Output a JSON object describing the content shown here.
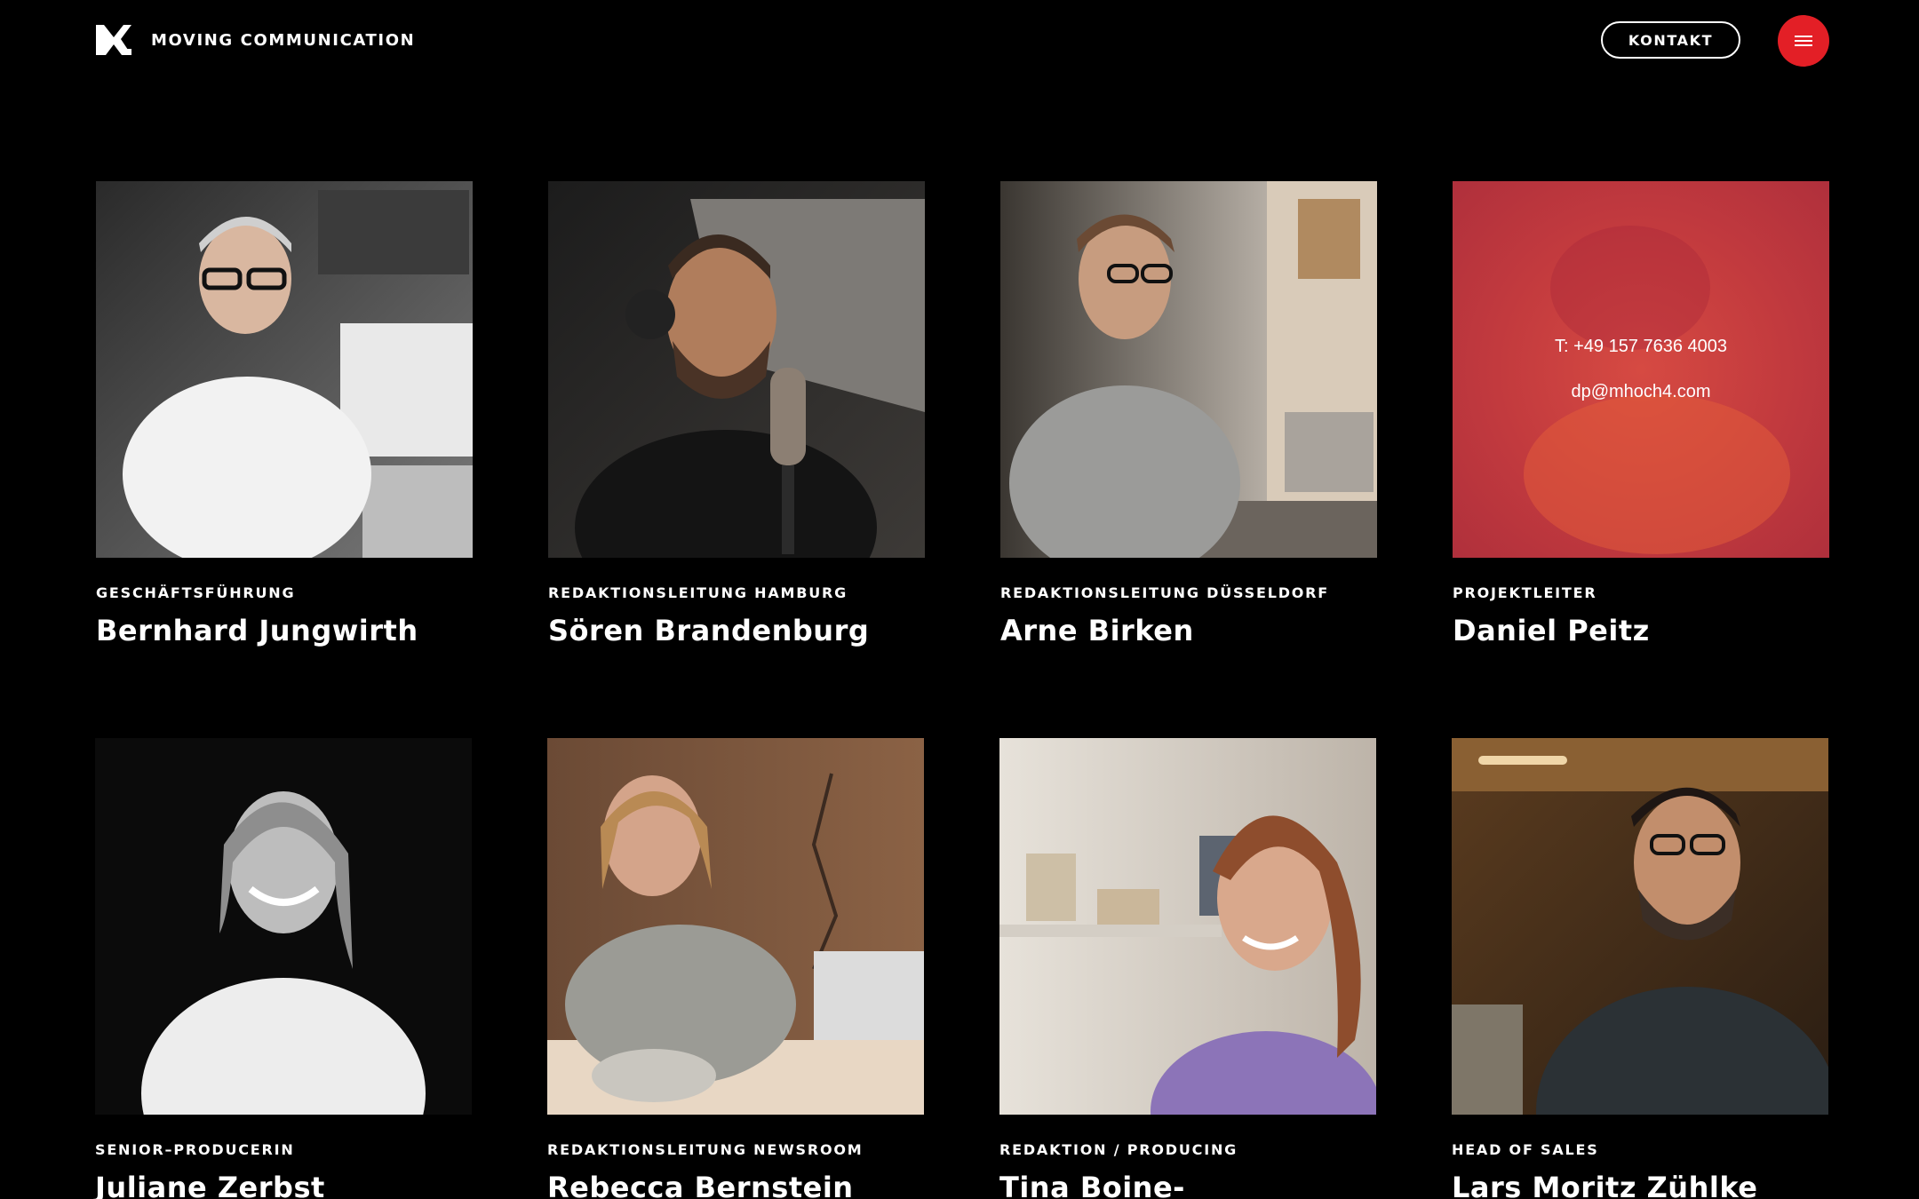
{
  "header": {
    "brand": "MOVING COMMUNICATION",
    "contact_label": "KONTAKT"
  },
  "team": [
    {
      "role": "GESCHÄFTSFÜHRUNG",
      "name": "Bernhard Jungwirth"
    },
    {
      "role": "REDAKTIONSLEITUNG HAMBURG",
      "name": "Sören Brandenburg"
    },
    {
      "role": "REDAKTIONSLEITUNG DÜSSELDORF",
      "name": "Arne Birken"
    },
    {
      "role": "PROJEKTLEITER",
      "name": "Daniel Peitz",
      "phone": "T: +49 157 7636 4003",
      "email": "dp@mhoch4.com"
    },
    {
      "role": "SENIOR–PRODUCERIN",
      "name": "Juliane Zerbst"
    },
    {
      "role": "REDAKTIONSLEITUNG NEWSROOM",
      "name": "Rebecca Bernstein"
    },
    {
      "role": "REDAKTION / PRODUCING",
      "name": "Tina Boine-"
    },
    {
      "role": "HEAD OF SALES",
      "name": "Lars Moritz Zühlke"
    }
  ],
  "colors": {
    "accent": "#e31f26",
    "background": "#000000",
    "text": "#ffffff"
  }
}
